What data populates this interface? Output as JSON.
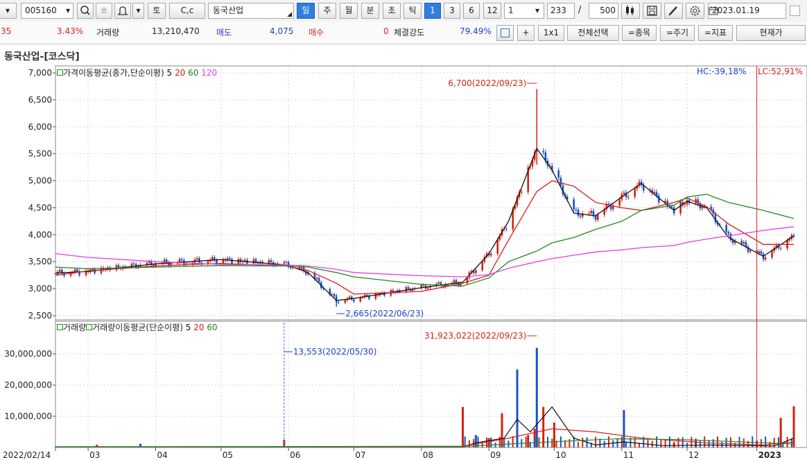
{
  "toolbar": {
    "code": "005160",
    "name": "동국산업",
    "btn_to": "토",
    "btn_cc": "C,c",
    "periods": [
      "일",
      "주",
      "월",
      "분",
      "초",
      "틱"
    ],
    "nums": [
      "1",
      "3",
      "6",
      "12"
    ],
    "count_select": "1",
    "count_value": "233",
    "slash": "/",
    "max_value": "500",
    "date": "2023.01.19"
  },
  "infobar": {
    "change_cut": "35",
    "pct": "3.43%",
    "vol_label": "거래량",
    "vol_value": "13,210,470",
    "sell_label": "매도",
    "sell_value": "4,075",
    "buy_label": "매수",
    "buy_value": "0",
    "strength_label": "체결강도",
    "strength_value": "79.49%",
    "plus": "+",
    "one_by_one": "1x1",
    "select_all": "전체선택",
    "item_btn": "=종목",
    "period_btn": "=주기",
    "indicator_btn": "=지표",
    "current_btn": "현재가"
  },
  "chart_title": "동국산업-[코스닥]",
  "price_legend": {
    "name": "가격이동평균(종가,단순이평)",
    "p5": "5",
    "p20": "20",
    "p60": "60",
    "p120": "120",
    "hc": "HC:-39,18%",
    "lc": "LC:52,91%"
  },
  "volume_legend": {
    "name1": "거래량",
    "name2": "거래량이동평균(단순이평)",
    "p5": "5",
    "p20": "20",
    "p60": "60"
  },
  "colors": {
    "up": "#d4210e",
    "down": "#1554c7",
    "ma5": "#111111",
    "ma20": "#e01818",
    "ma60": "#1f8a1f",
    "ma120": "#e43ce4",
    "crosshair": "#e02020"
  },
  "chart_data": [
    {
      "type": "line",
      "kind": "candlestick",
      "ylim": [
        2500,
        7000
      ],
      "y_ticks": [
        "7,000",
        "6,500",
        "6,000",
        "5,500",
        "5,000",
        "4,500",
        "4,000",
        "3,500",
        "3,000",
        "2,500"
      ],
      "annotations": [
        {
          "label": "6,700(2022/09/23)",
          "x": "2022-09-23",
          "y": 6700
        },
        {
          "label": "2,665(2022/06/23)",
          "x": "2022-06-23",
          "y": 2665
        }
      ],
      "series": [
        {
          "name": "5",
          "x": [
            "2022-02-14",
            "2022-03-01",
            "2022-04-01",
            "2022-05-01",
            "2022-05-31",
            "2022-06-10",
            "2022-06-23",
            "2022-07-01",
            "2022-08-01",
            "2022-08-20",
            "2022-09-01",
            "2022-09-10",
            "2022-09-23",
            "2022-09-30",
            "2022-10-10",
            "2022-10-20",
            "2022-11-01",
            "2022-11-10",
            "2022-11-25",
            "2022-12-01",
            "2022-12-10",
            "2022-12-20",
            "2023-01-05",
            "2023-01-19"
          ],
          "values": [
            3290,
            3320,
            3460,
            3540,
            3440,
            3300,
            2780,
            2820,
            3020,
            3120,
            3650,
            4250,
            5600,
            5200,
            4400,
            4350,
            4700,
            4950,
            4450,
            4620,
            4500,
            3950,
            3600,
            3980
          ]
        },
        {
          "name": "20",
          "x": [
            "2022-02-14",
            "2022-03-01",
            "2022-04-01",
            "2022-05-01",
            "2022-05-31",
            "2022-06-10",
            "2022-06-23",
            "2022-07-01",
            "2022-08-01",
            "2022-08-20",
            "2022-09-01",
            "2022-09-10",
            "2022-09-23",
            "2022-09-30",
            "2022-10-10",
            "2022-10-20",
            "2022-11-01",
            "2022-11-10",
            "2022-11-25",
            "2022-12-01",
            "2022-12-10",
            "2022-12-20",
            "2023-01-05",
            "2023-01-19"
          ],
          "values": [
            3250,
            3330,
            3420,
            3470,
            3420,
            3340,
            3100,
            2900,
            2950,
            3100,
            3250,
            3900,
            4800,
            5000,
            4900,
            4600,
            4500,
            4450,
            4600,
            4680,
            4520,
            4200,
            3820,
            3820
          ]
        },
        {
          "name": "60",
          "x": [
            "2022-02-14",
            "2022-03-01",
            "2022-04-01",
            "2022-05-01",
            "2022-05-31",
            "2022-06-10",
            "2022-06-23",
            "2022-07-01",
            "2022-08-01",
            "2022-08-20",
            "2022-09-01",
            "2022-09-10",
            "2022-09-23",
            "2022-09-30",
            "2022-10-10",
            "2022-10-20",
            "2022-11-01",
            "2022-11-10",
            "2022-11-25",
            "2022-12-01",
            "2022-12-10",
            "2022-12-20",
            "2023-01-05",
            "2023-01-19"
          ],
          "values": [
            3400,
            3370,
            3400,
            3430,
            3420,
            3400,
            3300,
            3220,
            3080,
            3050,
            3200,
            3500,
            3700,
            3850,
            3950,
            4100,
            4250,
            4450,
            4550,
            4700,
            4750,
            4600,
            4450,
            4300
          ]
        },
        {
          "name": "120",
          "x": [
            "2022-02-14",
            "2022-03-01",
            "2022-04-01",
            "2022-05-01",
            "2022-05-31",
            "2022-06-10",
            "2022-06-23",
            "2022-07-01",
            "2022-08-01",
            "2022-08-20",
            "2022-09-01",
            "2022-09-10",
            "2022-09-23",
            "2022-09-30",
            "2022-10-10",
            "2022-10-20",
            "2022-11-01",
            "2022-11-10",
            "2022-11-25",
            "2022-12-01",
            "2022-12-10",
            "2022-12-20",
            "2023-01-05",
            "2023-01-19"
          ],
          "values": [
            3650,
            3580,
            3500,
            3450,
            3440,
            3420,
            3360,
            3300,
            3240,
            3220,
            3260,
            3380,
            3500,
            3560,
            3620,
            3680,
            3720,
            3760,
            3800,
            3860,
            3920,
            3980,
            4080,
            4150
          ]
        }
      ]
    },
    {
      "type": "bar",
      "ylim": [
        0,
        40000000
      ],
      "y_ticks": [
        "30,000,000",
        "20,000,000",
        "10,000,000"
      ],
      "annotations": [
        {
          "label": "31,923,022(2022/09/23)",
          "x": "2022-09-23",
          "y": 31923022
        },
        {
          "label": "13,553(2022/05/30)",
          "x": "2022-05-30",
          "y": 13553
        }
      ],
      "categories": [
        "2022-03-05",
        "2022-03-25",
        "2022-05-30",
        "2022-08-20",
        "2022-08-26",
        "2022-09-01",
        "2022-09-07",
        "2022-09-14",
        "2022-09-19",
        "2022-09-22",
        "2022-09-23",
        "2022-09-26",
        "2022-10-01",
        "2022-11-02",
        "2022-11-25",
        "2022-12-05",
        "2023-01-02",
        "2023-01-13",
        "2023-01-19"
      ],
      "values": [
        900000,
        1200000,
        2500000,
        13000000,
        4000000,
        3000000,
        11000000,
        25000000,
        4000000,
        6000000,
        31923022,
        13000000,
        8000000,
        12000000,
        1500000,
        2500000,
        2000000,
        9500000,
        13210470
      ],
      "x_ticks": [
        "2022/02/14",
        "03",
        "04",
        "05",
        "06",
        "07",
        "08",
        "09",
        "10",
        "11",
        "12",
        "2023"
      ]
    }
  ]
}
